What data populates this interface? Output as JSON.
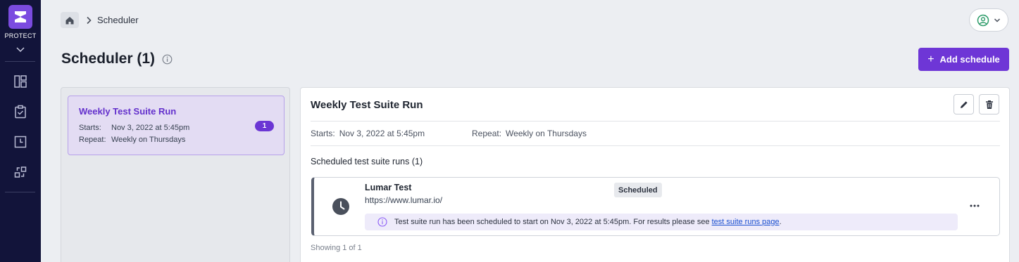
{
  "sidebar": {
    "product_label": "PROTECT",
    "icons": [
      "dashboard-icon",
      "clipboard-check-icon",
      "history-icon",
      "integrations-icon"
    ]
  },
  "breadcrumb": {
    "current": "Scheduler"
  },
  "page": {
    "title": "Scheduler (1)",
    "add_button_label": "Add schedule",
    "add_button_icon": "+"
  },
  "colors": {
    "accent": "#6e36d6",
    "sidebar": "#12143a",
    "link": "#1a4fd0"
  },
  "list": {
    "items": [
      {
        "title": "Weekly Test Suite Run",
        "starts_key": "Starts:",
        "starts_value": "Nov 3, 2022 at 5:45pm",
        "repeat_key": "Repeat:",
        "repeat_value": "Weekly on Thursdays",
        "count": "1"
      }
    ]
  },
  "detail": {
    "title": "Weekly Test Suite Run",
    "starts_key": "Starts:",
    "starts_value": "Nov 3, 2022 at 5:45pm",
    "repeat_key": "Repeat:",
    "repeat_value": "Weekly on Thursdays",
    "section_title": "Scheduled test suite runs (1)",
    "runs": [
      {
        "name": "Lumar Test",
        "url": "https://www.lumar.io/",
        "status": "Scheduled",
        "notice_text": "Test suite run has been scheduled to start on Nov 3, 2022 at 5:45pm. For results please see",
        "notice_link": "test suite runs page",
        "notice_suffix": "."
      }
    ],
    "showing": "Showing 1 of 1"
  }
}
